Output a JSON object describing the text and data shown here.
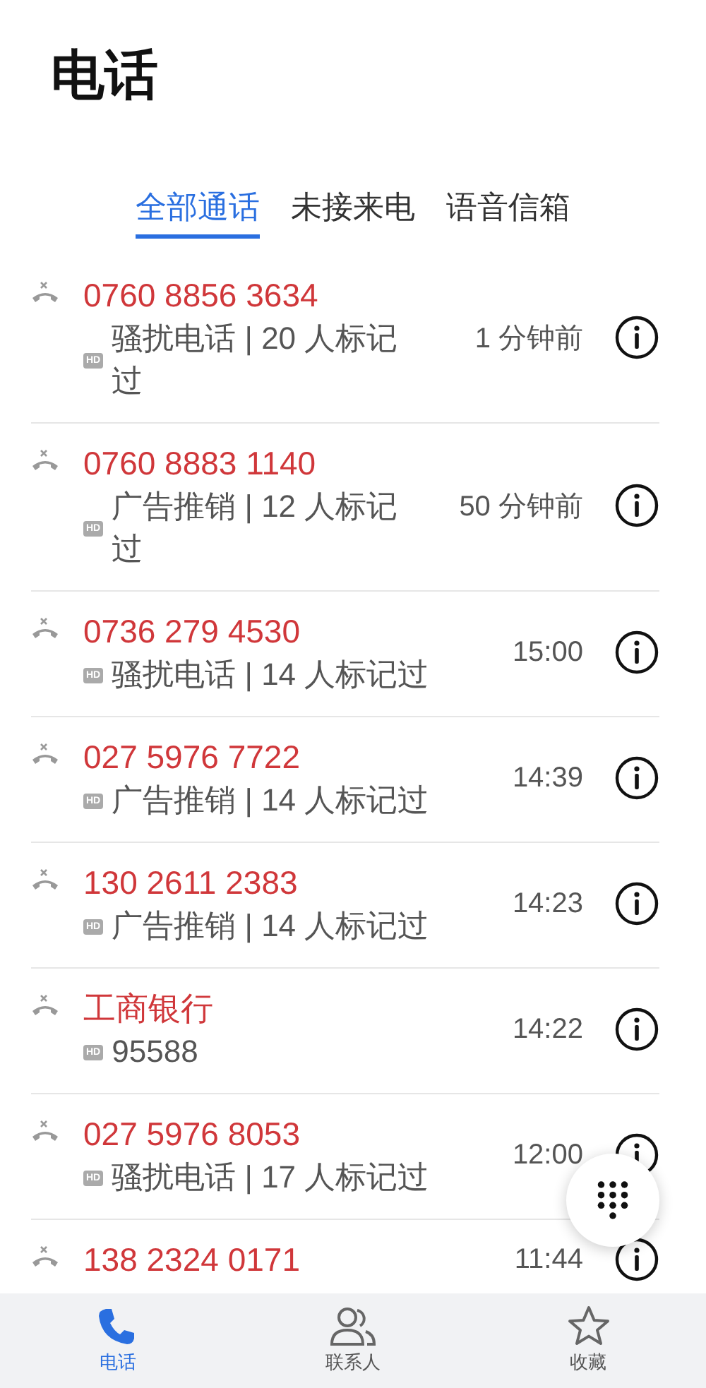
{
  "title": "电话",
  "tabs": [
    {
      "label": "全部通话",
      "selected": true
    },
    {
      "label": "未接来电",
      "selected": false
    },
    {
      "label": "语音信箱",
      "selected": false
    }
  ],
  "calls": [
    {
      "name": "0760 8856 3634",
      "badge": "HD",
      "detail": "骚扰电话 | 20 人标记过",
      "time": "1 分钟前"
    },
    {
      "name": "0760 8883 1140",
      "badge": "HD",
      "detail": "广告推销 | 12 人标记过",
      "time": "50 分钟前"
    },
    {
      "name": "0736 279 4530",
      "badge": "HD",
      "detail": "骚扰电话 | 14 人标记过",
      "time": "15:00"
    },
    {
      "name": "027 5976 7722",
      "badge": "HD",
      "detail": "广告推销 | 14 人标记过",
      "time": "14:39"
    },
    {
      "name": "130 2611 2383",
      "badge": "HD",
      "detail": "广告推销 | 14 人标记过",
      "time": "14:23"
    },
    {
      "name": "工商银行",
      "badge": "HD",
      "detail": "95588",
      "time": "14:22"
    },
    {
      "name": "027 5976 8053",
      "badge": "HD",
      "detail": "骚扰电话 | 17 人标记过",
      "time": "12:00"
    },
    {
      "name": "138 2324 0171",
      "time": "11:44"
    }
  ],
  "nav": [
    {
      "label": "电话",
      "selected": true
    },
    {
      "label": "联系人",
      "selected": false
    },
    {
      "label": "收藏",
      "selected": false
    }
  ]
}
